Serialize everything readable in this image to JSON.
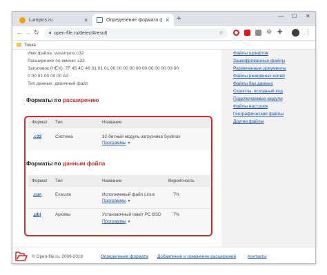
{
  "browser": {
    "tabs": [
      {
        "title": "Lumpics.ru",
        "active": false
      },
      {
        "title": "Определение формата файла",
        "active": true
      }
    ],
    "new_tab": "+",
    "window_controls": {
      "minimize": "—",
      "maximize": "☐",
      "close": "✕"
    },
    "address": "open-file.ru/detect#result",
    "bookmarks": [
      {
        "label": "Точка"
      }
    ]
  },
  "file_info": {
    "lines": [
      "Имя файла: vesamenu.c32",
      "Расширение по имени: c32",
      "Заголовок (HEX): 7F 45 4C 46 01 01 01 00 00 00 00 00 00 00 00 00 03 00",
      "0 00 01 00 00 00 A0",
      "Тип данных: двоичный файл"
    ]
  },
  "by_extension": {
    "heading_prefix": "Форматы по ",
    "heading_highlight": "расширению",
    "columns": [
      "Формат",
      "Тип",
      "Название"
    ],
    "rows": [
      {
        "format": ".c32",
        "type": "Система",
        "name": "32-битный модуль загрузчика Syslinux",
        "programs": "Программы"
      }
    ]
  },
  "by_data": {
    "heading_prefix": "Форматы по ",
    "heading_highlight": "данным файла",
    "columns": [
      "Формат",
      "Тип",
      "Название",
      "Вероятность"
    ],
    "rows": [
      {
        "format": ".run",
        "type": "Execute",
        "name": "Исполняемый файл Linux",
        "probability": "7%",
        "programs": "Программы"
      },
      {
        "format": ".pbi",
        "type": "Архивы",
        "name": "Установочный пакет PC BSD",
        "probability": "7%",
        "programs": "Программы"
      }
    ]
  },
  "sidebar": {
    "links": [
      "Файлы шрифтов",
      "Зашифрованные файлы",
      "Размеченные документы",
      "Файлы резервных копий",
      "Файлы баз данных",
      "Скрипты, исходный код",
      "Подключаемые модули",
      "Файлы настроек",
      "Географические файлы",
      "Другие файлы"
    ]
  },
  "footer": {
    "copyright": "© Open-file.ru, 2008-2019",
    "links": [
      "Определение формата",
      "Добавление и изменение расширений",
      "Контакты"
    ]
  },
  "colors": {
    "accent_red": "#e0262a",
    "link_blue": "#1a55b8",
    "logo_red": "#e0262a"
  }
}
